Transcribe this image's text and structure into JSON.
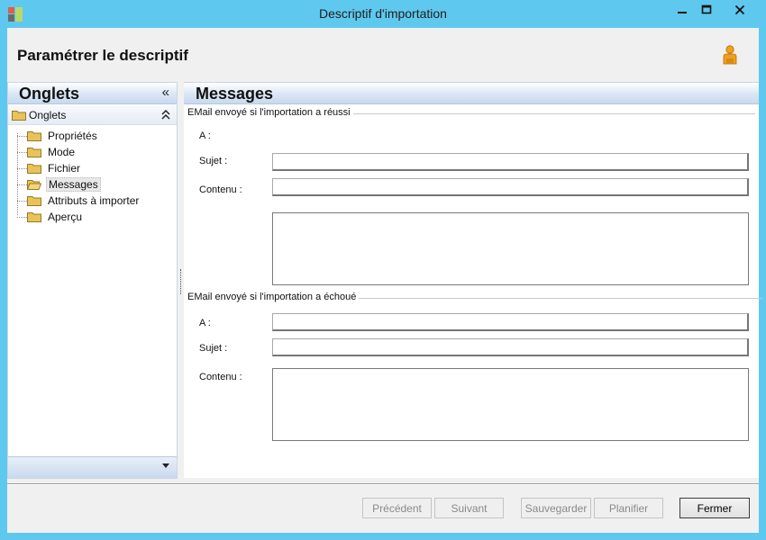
{
  "window": {
    "title": "Descriptif d'importation",
    "controls": {
      "minimize_icon": "minimize-icon",
      "maximize_icon": "maximize-icon",
      "close_icon": "close-icon"
    }
  },
  "header": {
    "title": "Paramétrer le descriptif",
    "user_icon": "user-icon"
  },
  "sidebar": {
    "title": "Onglets",
    "collapse_glyph": "«",
    "group": {
      "label": "Onglets",
      "chevron": "⌃⌃"
    },
    "items": [
      {
        "label": "Propriétés",
        "selected": false
      },
      {
        "label": "Mode",
        "selected": false
      },
      {
        "label": "Fichier",
        "selected": false
      },
      {
        "label": "Messages",
        "selected": true
      },
      {
        "label": "Attributs à importer",
        "selected": false
      },
      {
        "label": "Aperçu",
        "selected": false
      }
    ]
  },
  "content": {
    "title": "Messages",
    "success_group": {
      "caption": "EMail envoyé si l'importation a réussi",
      "to_label": "A :",
      "to_value": "",
      "subject_label": "Sujet :",
      "subject_value": "",
      "body_label": "Contenu :",
      "body_value": ""
    },
    "failure_group": {
      "caption": "EMail envoyé si l'importation a échoué",
      "to_label": "A :",
      "to_value": "",
      "subject_label": "Sujet :",
      "subject_value": "",
      "body_label": "Contenu :",
      "body_value": ""
    }
  },
  "buttons": {
    "previous": {
      "label": "Précédent",
      "enabled": false
    },
    "next": {
      "label": "Suivant",
      "enabled": false
    },
    "save": {
      "label": "Sauvegarder",
      "enabled": false
    },
    "schedule": {
      "label": "Planifier",
      "enabled": false
    },
    "close": {
      "label": "Fermer",
      "enabled": true
    }
  },
  "colors": {
    "window_frame": "#5fc8ee",
    "client_bg": "#f0f0f0",
    "pane_header_gradient_end": "#c8d9ee",
    "folder_yellow": "#e8c35a",
    "user_icon_orange": "#f0a020"
  }
}
